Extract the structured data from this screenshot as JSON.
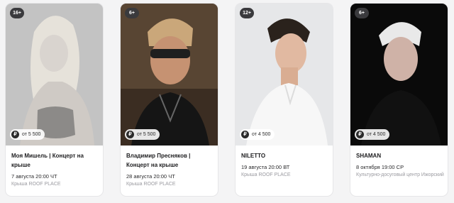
{
  "events": [
    {
      "age": "16+",
      "price": "от 5 500",
      "title": "Моя Мишель | Концерт на крыше",
      "date": "7 августа 20:00 ЧТ",
      "venue": "Крыша ROOF PLACE"
    },
    {
      "age": "6+",
      "price": "от 5 500",
      "title": "Владимир Пресняков | Концерт на крыше",
      "date": "28 августа 20:00 ЧТ",
      "venue": "Крыша ROOF PLACE"
    },
    {
      "age": "12+",
      "price": "от 4 500",
      "title": "NILETTO",
      "date": "19 августа 20:00 ВТ",
      "venue": "Крыша ROOF PLACE"
    },
    {
      "age": "6+",
      "price": "от 4 500",
      "title": "SHAMAN",
      "date": "8 октября 19:00 СР",
      "venue": "Культурно-досуговый центр Ижорский"
    }
  ],
  "currency_symbol": "₽"
}
